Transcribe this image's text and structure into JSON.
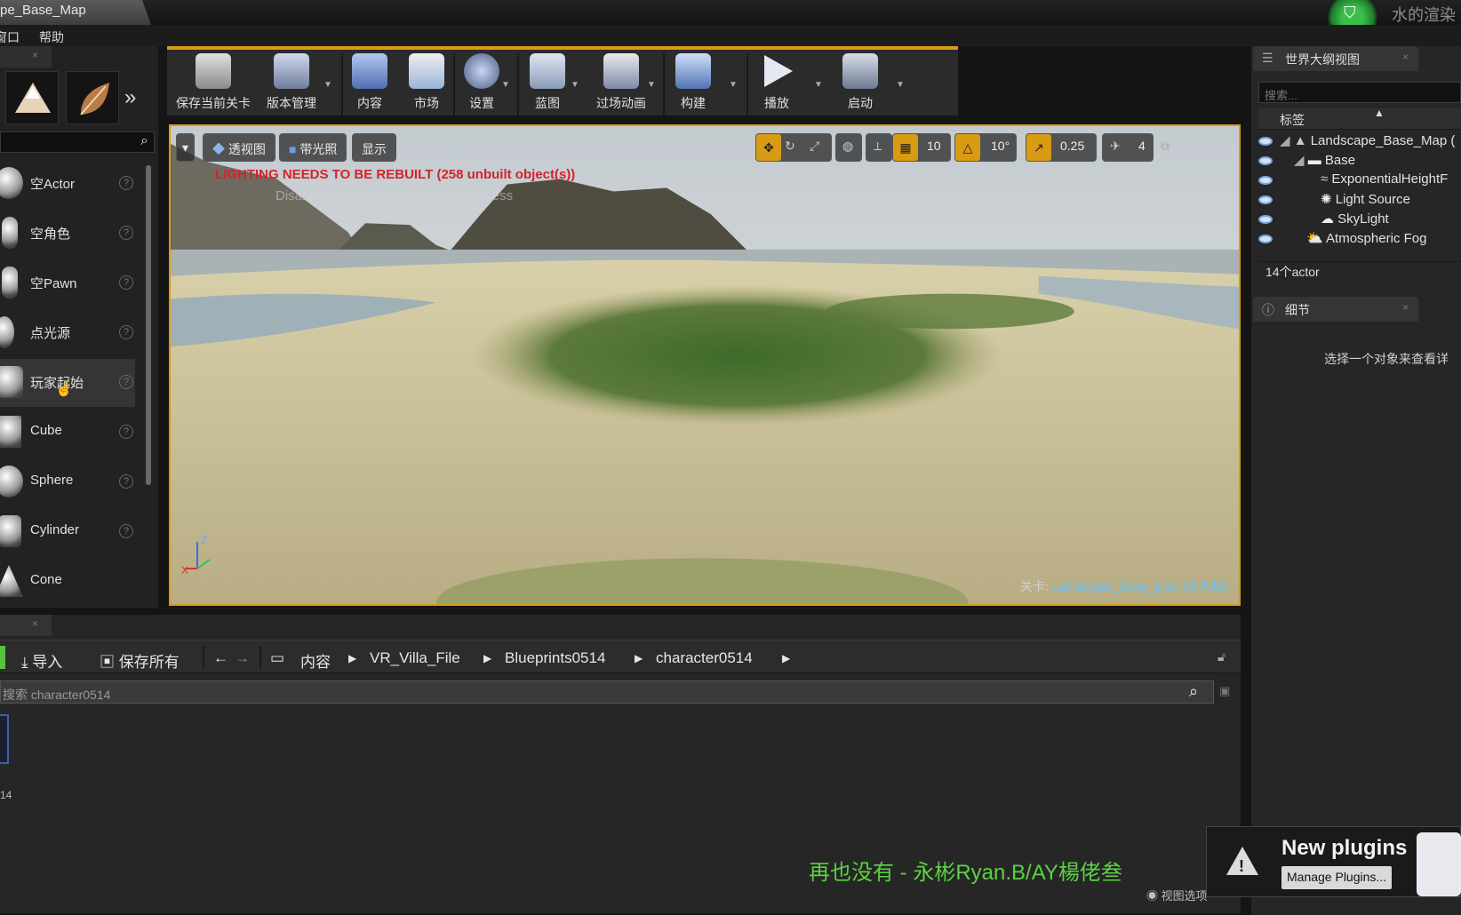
{
  "window": {
    "title": "pe_Base_Map"
  },
  "menu": {
    "window": "窗口",
    "help": "帮助"
  },
  "brand": {
    "text": "水的渲染"
  },
  "place": {
    "items": [
      {
        "label": "空Actor"
      },
      {
        "label": "空角色"
      },
      {
        "label": "空Pawn"
      },
      {
        "label": "点光源"
      },
      {
        "label": "玩家起始"
      },
      {
        "label": "Cube"
      },
      {
        "label": "Sphere"
      },
      {
        "label": "Cylinder"
      },
      {
        "label": "Cone"
      }
    ]
  },
  "toolbar": {
    "save": "保存当前关卡",
    "source_control": "版本管理",
    "content": "内容",
    "marketplace": "市场",
    "settings": "设置",
    "blueprints": "蓝图",
    "cinematics": "过场动画",
    "build": "构建",
    "play": "播放",
    "launch": "启动"
  },
  "viewport": {
    "perspective": "透视图",
    "lit": "带光照",
    "show": "显示",
    "grid_snap": "10",
    "rotation_snap": "10°",
    "scale_snap": "0.25",
    "camera_speed": "4",
    "warning": "LIGHTING NEEDS TO BE REBUILT (258 unbuilt object(s))",
    "warning2": "DisableAllScreenMessages' to suppress",
    "level_prefix": "关卡:",
    "level_name": "Landscape_Base_Map (永久性)"
  },
  "outliner": {
    "tab": "世界大纲视图",
    "search_placeholder": "搜索...",
    "header": "标签",
    "rows": [
      {
        "label": "Landscape_Base_Map ("
      },
      {
        "label": "Base"
      },
      {
        "label": "ExponentialHeightF"
      },
      {
        "label": "Light Source"
      },
      {
        "label": "SkyLight"
      },
      {
        "label": "Atmospheric Fog"
      }
    ],
    "count": "14个actor"
  },
  "details": {
    "tab": "细节",
    "empty": "选择一个对象来查看详"
  },
  "content_browser": {
    "import": "导入",
    "save_all": "保存所有",
    "path": [
      "内容",
      "VR_Villa_File",
      "Blueprints0514",
      "character0514"
    ],
    "search_placeholder": "搜索 character0514",
    "asset_label": "14",
    "view_options": "视图选项"
  },
  "subtitle": "再也没有 - 永彬Ryan.B/AY楊佬叁",
  "notification": {
    "title": "New plugins",
    "button": "Manage Plugins..."
  },
  "colors": {
    "accent": "#d89b14",
    "warning_red": "#d3232a",
    "subtitle_green": "#5ad241",
    "link_blue": "#5ec3ff"
  }
}
